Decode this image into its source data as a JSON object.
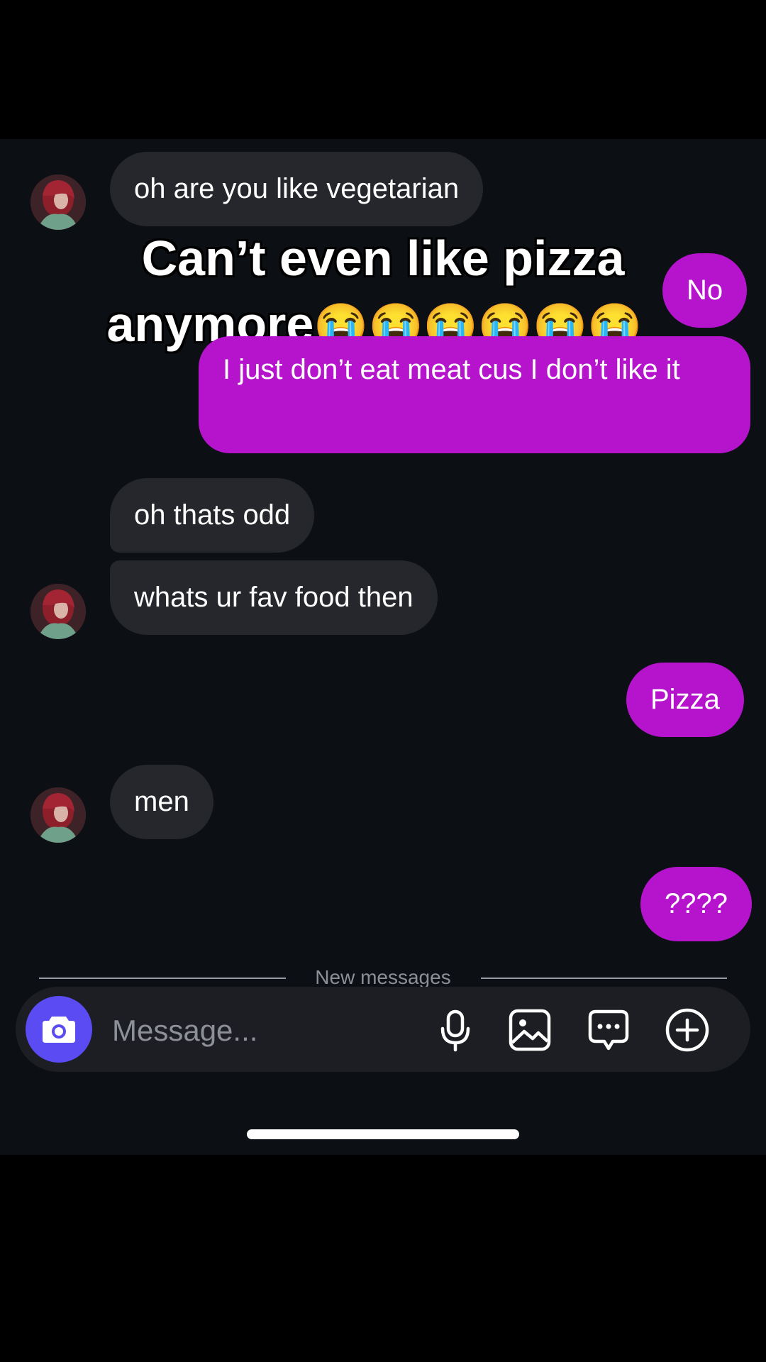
{
  "caption": {
    "line1": "Can’t even like pizza",
    "line2_text": "anymore",
    "line2_emoji": "😭😭😭😭😭😭"
  },
  "messages": [
    {
      "from": "them",
      "text": "oh are you like vegetarian"
    },
    {
      "from": "me",
      "text": "No"
    },
    {
      "from": "me",
      "text": "I just don’t eat meat cus I don’t like it"
    },
    {
      "from": "them",
      "text": "oh thats odd"
    },
    {
      "from": "them",
      "text": "whats ur fav food then"
    },
    {
      "from": "me",
      "text": "Pizza"
    },
    {
      "from": "them",
      "text": "men"
    },
    {
      "from": "me",
      "text": "????"
    }
  ],
  "divider": {
    "label": "New messages"
  },
  "composer": {
    "placeholder": "Message..."
  },
  "colors": {
    "outgoing_bubble": "#b514cc",
    "incoming_bubble": "#25272c",
    "camera_button": "#5a4bf2",
    "background": "#0c0f14"
  },
  "icons": [
    "camera-icon",
    "microphone-icon",
    "image-icon",
    "sticker-message-icon",
    "add-circle-icon"
  ]
}
